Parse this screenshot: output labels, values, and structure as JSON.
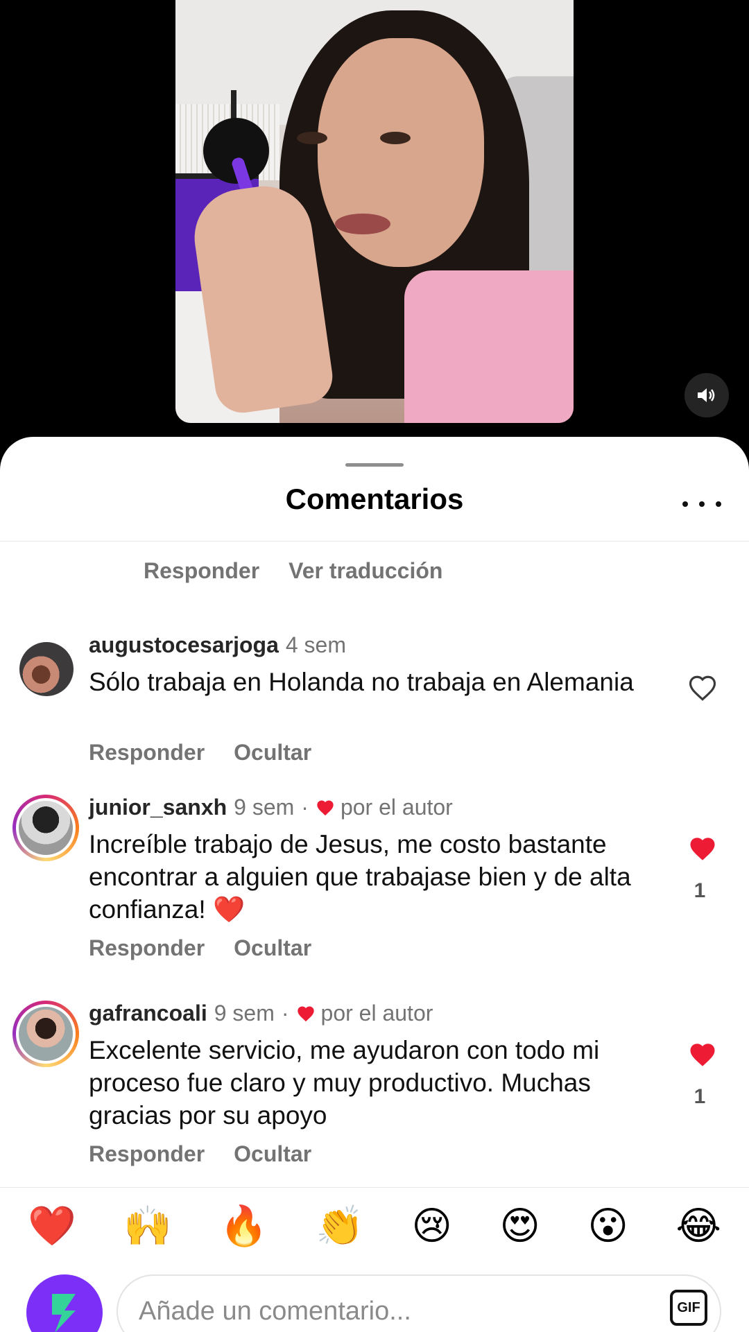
{
  "sheet": {
    "title": "Comentarios"
  },
  "partial_comment": {
    "reply_label": "Responder",
    "translate_label": "Ver traducción"
  },
  "comments": [
    {
      "username": "augustocesarjoga",
      "time": "4 sem",
      "text": "Sólo trabaja en Holanda no trabaja en Alemania",
      "reply_label": "Responder",
      "hide_label": "Ocultar",
      "liked": false,
      "like_count": ""
    },
    {
      "username": "junior_sanxh",
      "time": "9 sem",
      "author_badge": "por el autor",
      "text": "Increíble trabajo de Jesus, me costo bastante encontrar a alguien que trabajase bien y de alta confianza! ❤️",
      "reply_label": "Responder",
      "hide_label": "Ocultar",
      "liked": true,
      "like_count": "1"
    },
    {
      "username": "gafrancoali",
      "time": "9 sem",
      "author_badge": "por el autor",
      "text": "Excelente servicio,  me ayudaron con todo mi proceso fue claro y muy productivo. Muchas gracias por su apoyo",
      "reply_label": "Responder",
      "hide_label": "Ocultar",
      "liked": true,
      "like_count": "1"
    }
  ],
  "emoji_bar": [
    "❤️",
    "🙌",
    "🔥",
    "👏",
    "😢",
    "😍",
    "😮",
    "😂"
  ],
  "composer": {
    "placeholder": "Añade un comentario...",
    "gif_label": "GIF"
  },
  "colors": {
    "like_red": "#ed1c34",
    "secondary_text": "#737373",
    "avatar_purple": "#7b2ff7"
  },
  "icons": {
    "sound": "speaker-icon",
    "more": "ellipsis-icon",
    "like_empty": "heart-outline-icon",
    "like_filled": "heart-filled-icon"
  }
}
